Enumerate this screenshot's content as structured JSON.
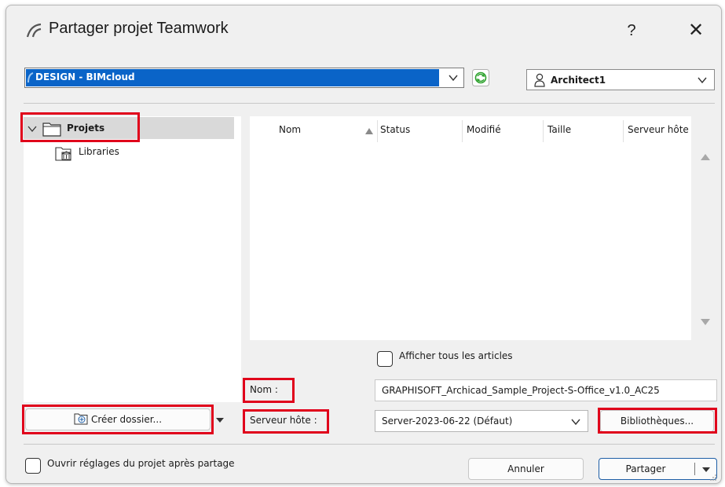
{
  "window": {
    "title": "Partager projet Teamwork",
    "help_label": "?",
    "close_label": "✕"
  },
  "server": {
    "selected": "DESIGN - BIMcloud",
    "icon": "refresh-icon",
    "accent_color": "#0a64c8"
  },
  "user": {
    "selected": "Architect1"
  },
  "tree": {
    "items": [
      {
        "label": "Projets",
        "icon": "folder-icon",
        "expanded": true,
        "selected": true
      },
      {
        "label": "Libraries",
        "icon": "library-folder-icon"
      }
    ]
  },
  "list": {
    "columns": [
      "Nom",
      "Status",
      "Modifié",
      "Taille",
      "Serveur hôte"
    ],
    "rows": [],
    "sort": "Nom ascending"
  },
  "show_all": {
    "label": "Afficher tous les articles",
    "checked": false
  },
  "form": {
    "name_label": "Nom :",
    "name_value": "GRAPHISOFT_Archicad_Sample_Project-S-Office_v1.0_AC25",
    "host_label": "Serveur hôte :",
    "host_value": "Server-2023-06-22 (Défaut)",
    "libraries_button": "Bibliothèques..."
  },
  "create_folder": {
    "label": "Créer dossier..."
  },
  "footer": {
    "open_settings_label": "Ouvrir réglages du projet après partage",
    "open_settings_checked": false,
    "cancel_label": "Annuler",
    "share_label": "Partager"
  },
  "highlight_color": "#e0001b"
}
